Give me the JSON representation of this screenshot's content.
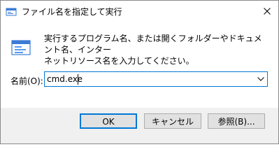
{
  "window": {
    "title": "ファイル名を指定して実行",
    "close_glyph": "✕"
  },
  "content": {
    "description": "実行するプログラム名、または開くフォルダーやドキュメント名、インター\nネットリソース名を入力してください。",
    "name_label": "名前(O):",
    "command_value": "cmd.exe",
    "dropdown_glyph": "⌵"
  },
  "buttons": {
    "ok": "OK",
    "cancel": "キャンセル",
    "browse": "参照(B)..."
  },
  "icons": {
    "title_icon": "run-dialog-icon",
    "run_icon": "run-program-icon",
    "close_icon": "close-icon",
    "dropdown_icon": "chevron-down-icon"
  },
  "colors": {
    "accent": "#0078d7",
    "footer_bg": "#f0f0f0",
    "button_bg": "#e1e1e1",
    "button_border": "#adadad"
  }
}
